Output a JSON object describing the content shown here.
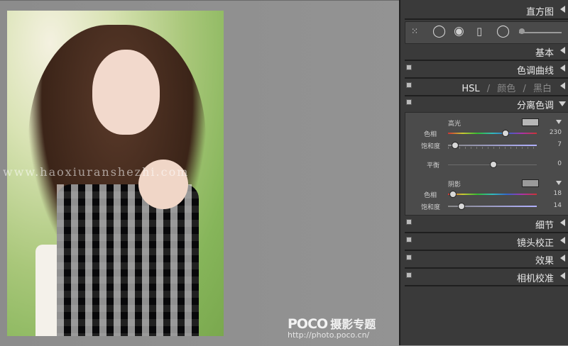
{
  "photo": {
    "watermark_url": "www.haoxiuranshezhi.com",
    "brand": "POCO",
    "brand_cn": "摄影专题",
    "brand_url": "http://photo.poco.cn/"
  },
  "panel": {
    "sections": {
      "histogram": "直方图",
      "basic": "基本",
      "tone_curve": "色调曲线",
      "hsl_parts": [
        "HSL",
        "/",
        "颜色",
        "/",
        "黑白"
      ],
      "split_toning": "分离色调",
      "detail": "细节",
      "lens": "镜头校正",
      "effects": "效果",
      "camera": "相机校准"
    },
    "split_toning": {
      "highlights_label": "高光",
      "hue_label": "色相",
      "sat_label": "饱和度",
      "balance_label": "平衡",
      "shadows_label": "阴影",
      "highlight_hue": 230,
      "highlight_sat": 7,
      "balance": 0,
      "shadow_hue": 18,
      "shadow_sat": 14,
      "highlight_hue_frac": 0.64,
      "highlight_sat_frac": 0.07,
      "balance_frac": 0.5,
      "shadow_hue_frac": 0.05,
      "shadow_sat_frac": 0.14
    },
    "colors": {
      "highlight_chip": "#b7b7b7",
      "shadow_chip": "#9a9a9a"
    }
  }
}
